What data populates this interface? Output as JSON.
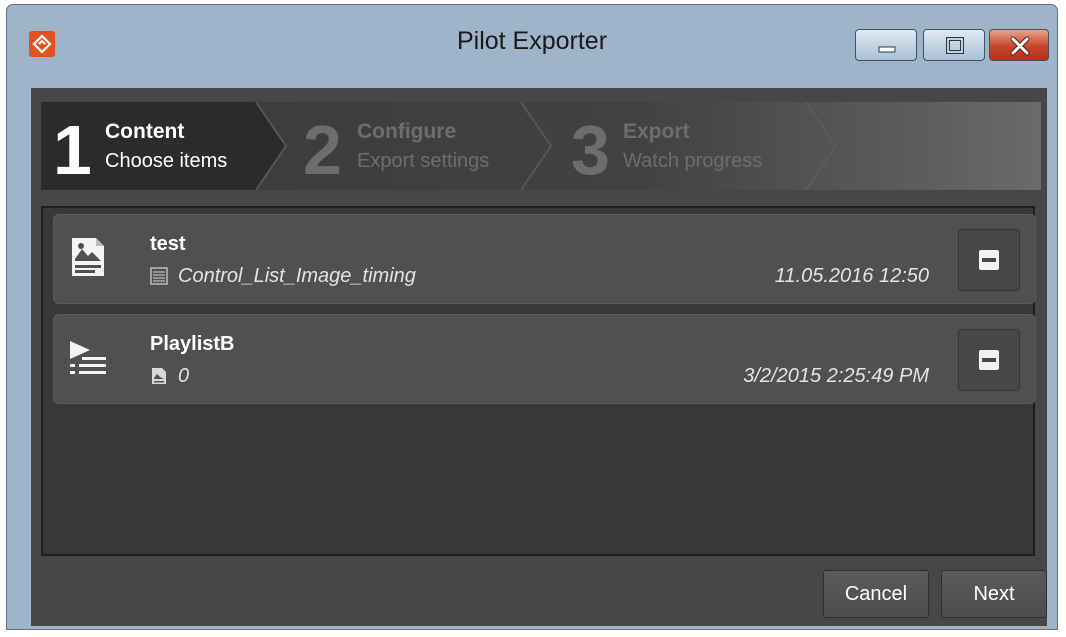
{
  "window": {
    "title": "Pilot Exporter",
    "app_icon": "pilot-logo-icon",
    "controls": [
      "minimize-icon",
      "maximize-icon",
      "close-icon"
    ],
    "accent": "#e0531f"
  },
  "wizard": {
    "steps": [
      {
        "number": "1",
        "title": "Content",
        "subtitle": "Choose items",
        "active": true
      },
      {
        "number": "2",
        "title": "Configure",
        "subtitle": "Export settings",
        "active": false
      },
      {
        "number": "3",
        "title": "Export",
        "subtitle": "Watch progress",
        "active": false
      }
    ]
  },
  "items": [
    {
      "name": "test",
      "type_icon": "image-document-icon",
      "sub_icon": "template-icon",
      "sub": "Control_List_Image_timing",
      "date": "11.05.2016 12:50",
      "remove_icon": "minus-icon"
    },
    {
      "name": "PlaylistB",
      "type_icon": "playlist-icon",
      "sub_icon": "image-document-icon",
      "sub": "0",
      "date": "3/2/2015 2:25:49 PM",
      "remove_icon": "minus-icon"
    }
  ],
  "footer": {
    "cancel_label": "Cancel",
    "next_label": "Next"
  }
}
